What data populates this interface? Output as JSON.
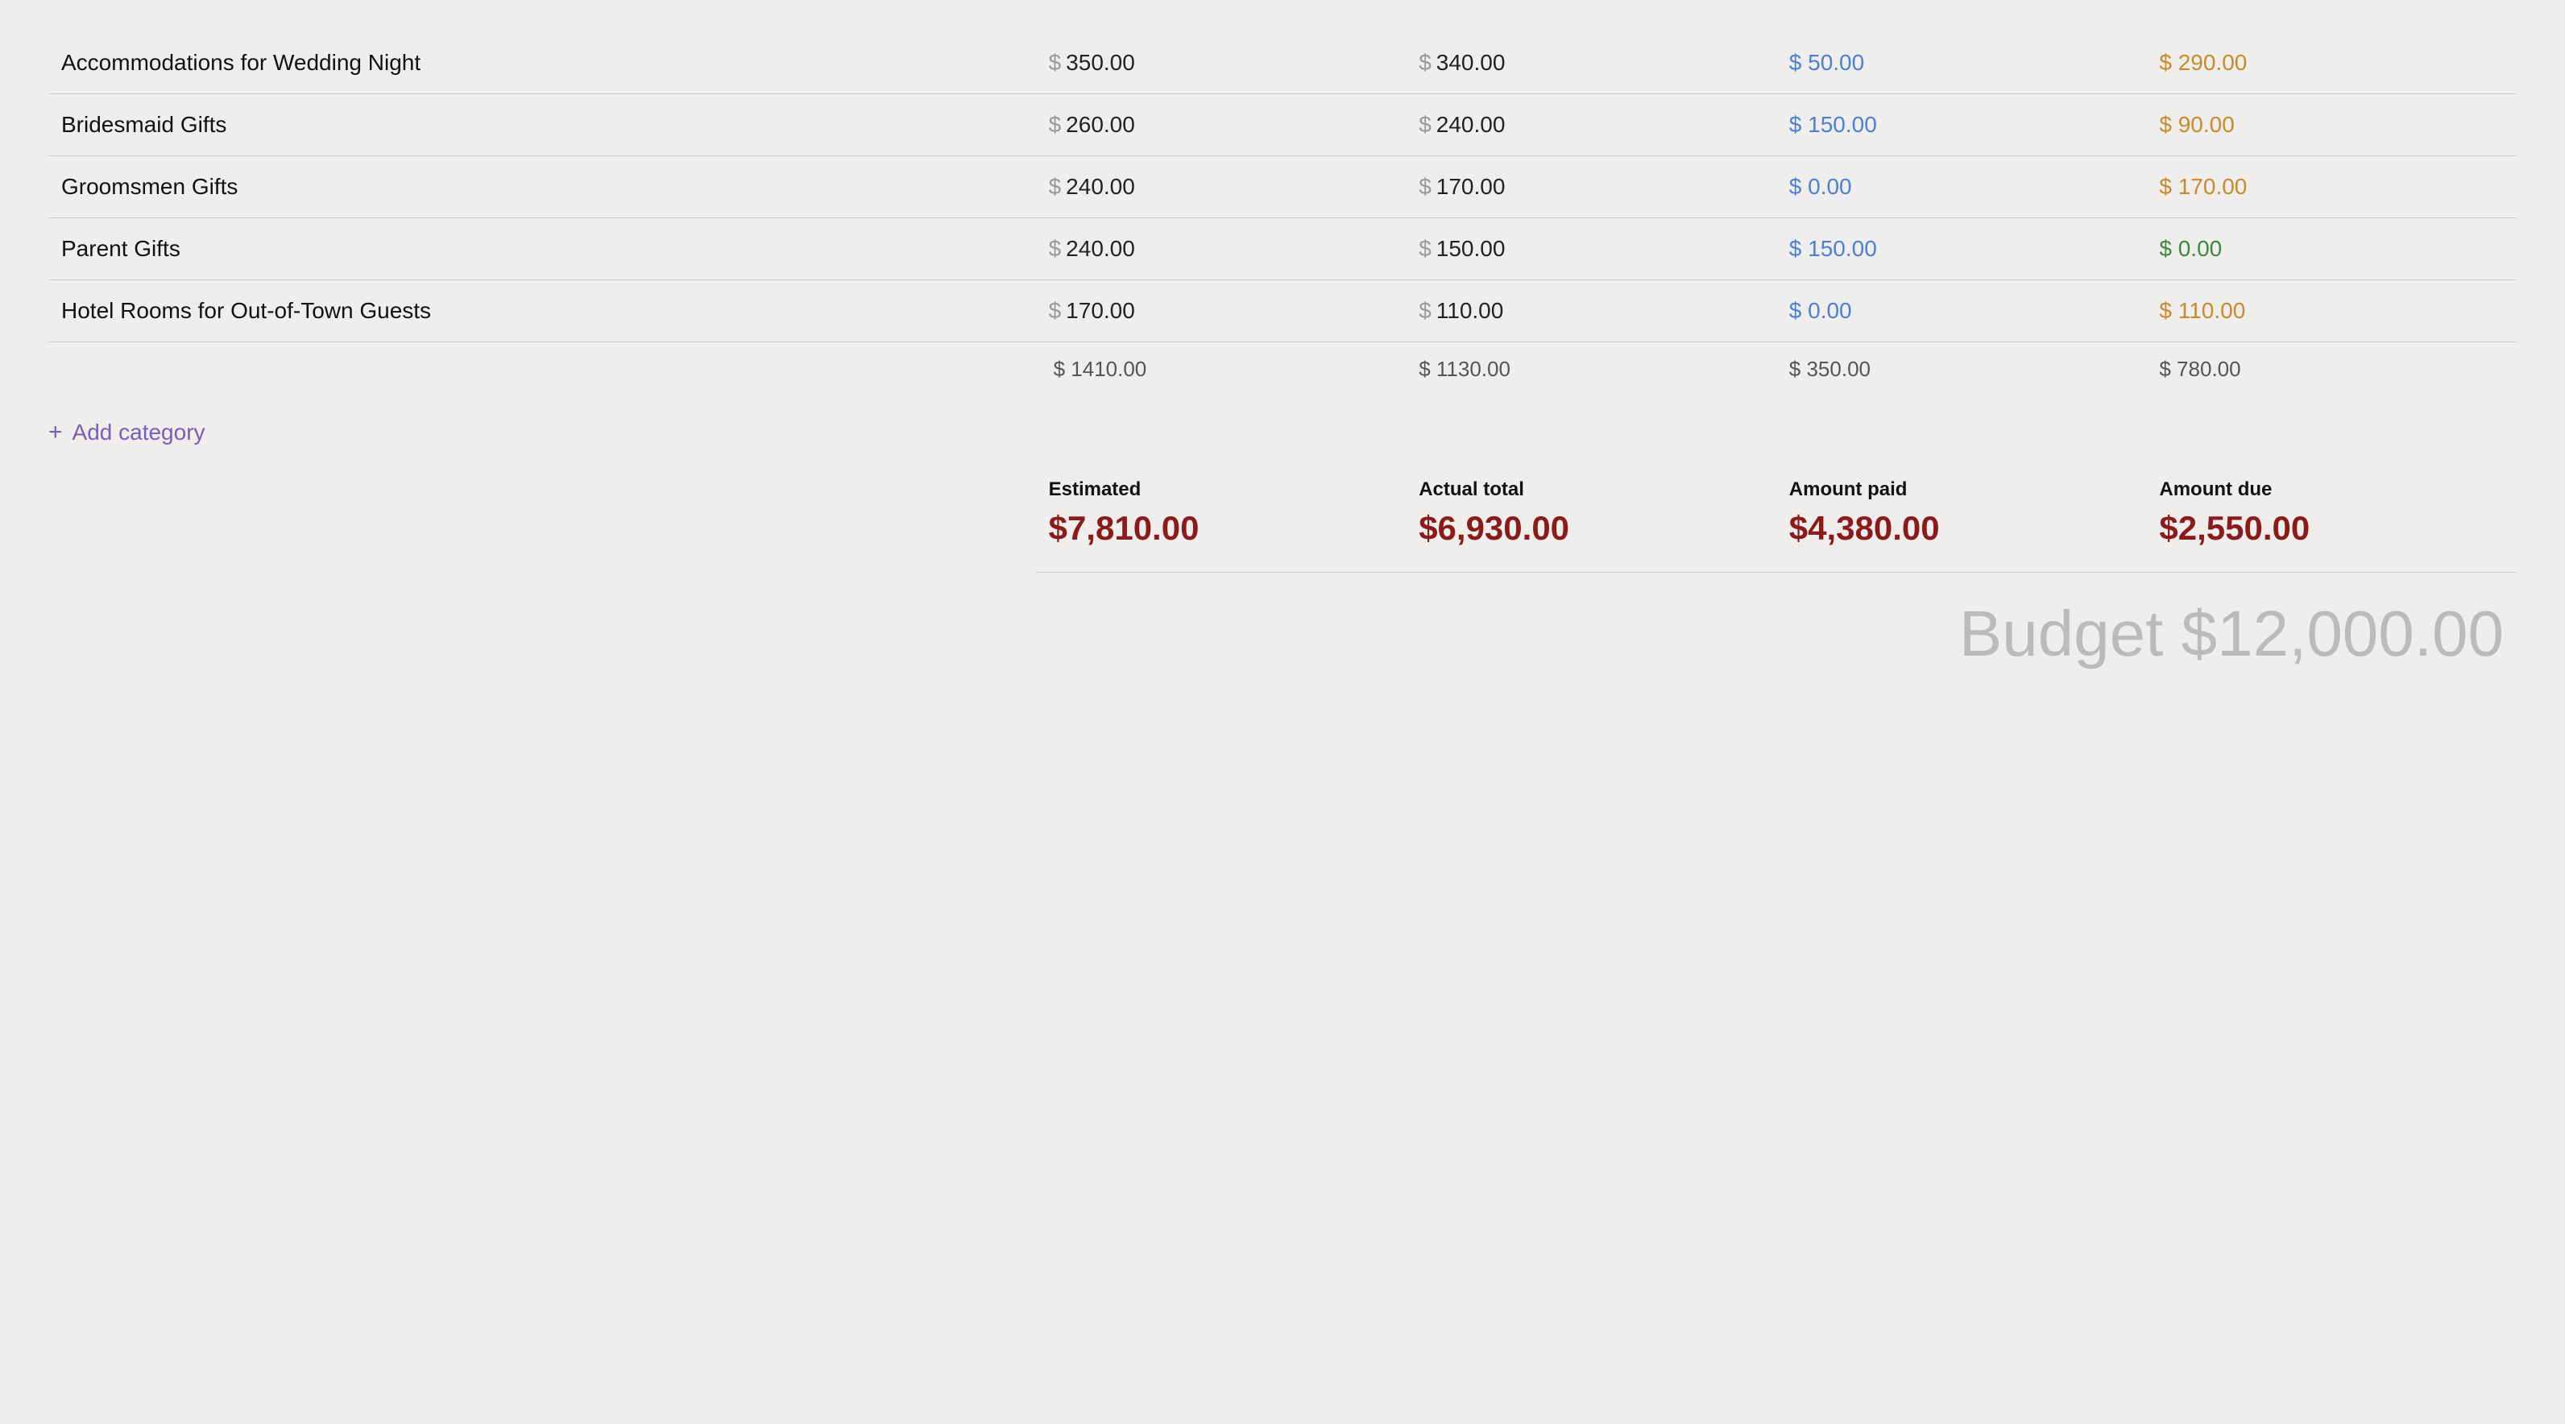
{
  "rows": [
    {
      "name": "Accommodations for Wedding Night",
      "estimated": "350.00",
      "actual": "340.00",
      "paid": "50.00",
      "due": "290.00",
      "paid_color": "blue",
      "due_color": "orange"
    },
    {
      "name": "Bridesmaid Gifts",
      "estimated": "260.00",
      "actual": "240.00",
      "paid": "150.00",
      "due": "90.00",
      "paid_color": "blue",
      "due_color": "orange"
    },
    {
      "name": "Groomsmen Gifts",
      "estimated": "240.00",
      "actual": "170.00",
      "paid": "0.00",
      "due": "170.00",
      "paid_color": "blue",
      "due_color": "orange"
    },
    {
      "name": "Parent Gifts",
      "estimated": "240.00",
      "actual": "150.00",
      "paid": "150.00",
      "due": "0.00",
      "paid_color": "blue",
      "due_color": "green"
    },
    {
      "name": "Hotel Rooms for Out-of-Town Guests",
      "estimated": "170.00",
      "actual": "110.00",
      "paid": "0.00",
      "due": "110.00",
      "paid_color": "blue",
      "due_color": "orange"
    }
  ],
  "totals": {
    "estimated": "$ 1410.00",
    "actual": "$ 1130.00",
    "paid": "$ 350.00",
    "due": "$ 780.00"
  },
  "add_category_label": "Add category",
  "summary": {
    "estimated_label": "Estimated",
    "actual_label": "Actual total",
    "paid_label": "Amount paid",
    "due_label": "Amount due",
    "estimated_value": "$7,810.00",
    "actual_value": "$6,930.00",
    "paid_value": "$4,380.00",
    "due_value": "$2,550.00"
  },
  "budget_label": "Budget $12,000.00"
}
